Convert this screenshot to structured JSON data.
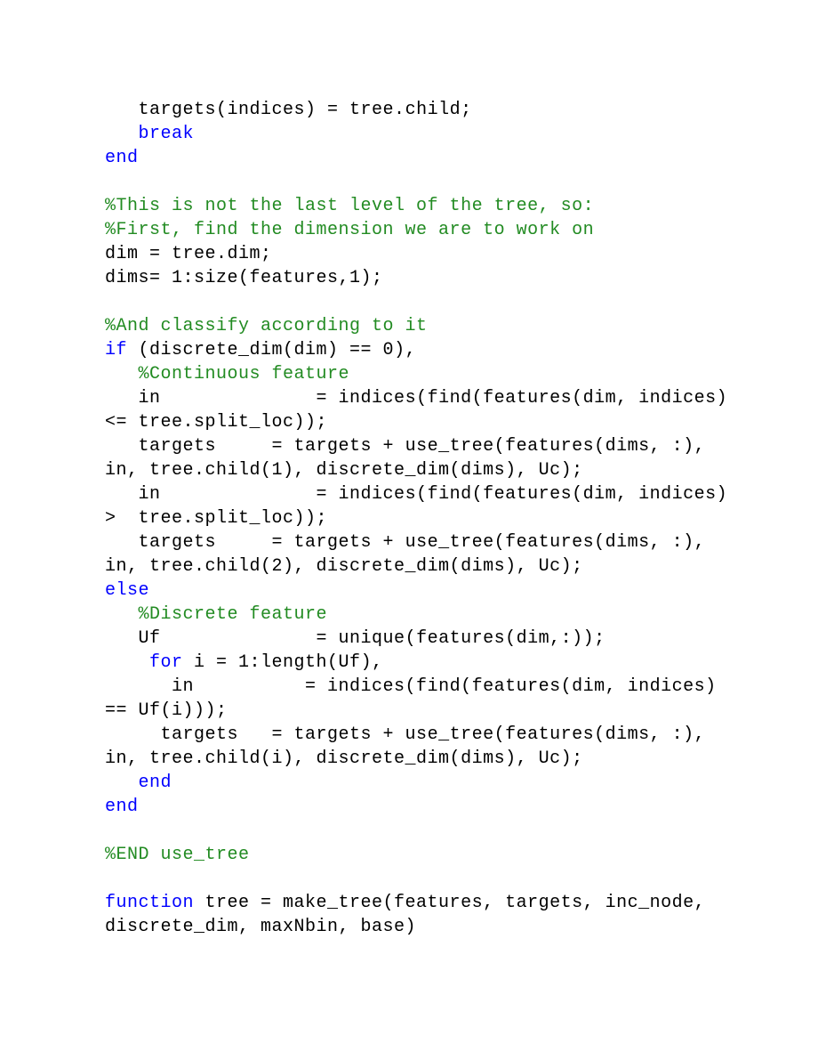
{
  "lines": [
    {
      "segs": [
        {
          "cls": "t",
          "txt": "   targets(indices) = tree.child;"
        }
      ]
    },
    {
      "segs": [
        {
          "cls": "t",
          "txt": "   "
        },
        {
          "cls": "k",
          "txt": "break"
        }
      ]
    },
    {
      "segs": [
        {
          "cls": "k",
          "txt": "end"
        }
      ]
    },
    {
      "segs": [
        {
          "cls": "t",
          "txt": " "
        }
      ]
    },
    {
      "segs": [
        {
          "cls": "c",
          "txt": "%This is not the last level of the tree, so:"
        }
      ]
    },
    {
      "segs": [
        {
          "cls": "c",
          "txt": "%First, find the dimension we are to work on"
        }
      ]
    },
    {
      "segs": [
        {
          "cls": "t",
          "txt": "dim = tree.dim;"
        }
      ]
    },
    {
      "segs": [
        {
          "cls": "t",
          "txt": "dims= 1:size(features,1);"
        }
      ]
    },
    {
      "segs": [
        {
          "cls": "t",
          "txt": " "
        }
      ]
    },
    {
      "segs": [
        {
          "cls": "c",
          "txt": "%And classify according to it"
        }
      ]
    },
    {
      "segs": [
        {
          "cls": "k",
          "txt": "if"
        },
        {
          "cls": "t",
          "txt": " (discrete_dim(dim) == 0),"
        }
      ]
    },
    {
      "segs": [
        {
          "cls": "t",
          "txt": "   "
        },
        {
          "cls": "c",
          "txt": "%Continuous feature"
        }
      ]
    },
    {
      "segs": [
        {
          "cls": "t",
          "txt": "   in              = indices(find(features(dim, indices) <= tree.split_loc));"
        }
      ]
    },
    {
      "segs": [
        {
          "cls": "t",
          "txt": "   targets     = targets + use_tree(features(dims, :), in, tree.child(1), discrete_dim(dims), Uc);"
        }
      ]
    },
    {
      "segs": [
        {
          "cls": "t",
          "txt": "   in              = indices(find(features(dim, indices) >  tree.split_loc));"
        }
      ]
    },
    {
      "segs": [
        {
          "cls": "t",
          "txt": "   targets     = targets + use_tree(features(dims, :), in, tree.child(2), discrete_dim(dims), Uc);"
        }
      ]
    },
    {
      "segs": [
        {
          "cls": "k",
          "txt": "else"
        }
      ]
    },
    {
      "segs": [
        {
          "cls": "t",
          "txt": "   "
        },
        {
          "cls": "c",
          "txt": "%Discrete feature"
        }
      ]
    },
    {
      "segs": [
        {
          "cls": "t",
          "txt": "   Uf              = unique(features(dim,:));"
        }
      ]
    },
    {
      "segs": [
        {
          "cls": "t",
          "txt": "    "
        },
        {
          "cls": "k",
          "txt": "for"
        },
        {
          "cls": "t",
          "txt": " i = 1:length(Uf),"
        }
      ]
    },
    {
      "segs": [
        {
          "cls": "t",
          "txt": "      in          = indices(find(features(dim, indices) == Uf(i)));"
        }
      ]
    },
    {
      "segs": [
        {
          "cls": "t",
          "txt": "     targets   = targets + use_tree(features(dims, :), in, tree.child(i), discrete_dim(dims), Uc);"
        }
      ]
    },
    {
      "segs": [
        {
          "cls": "t",
          "txt": "   "
        },
        {
          "cls": "k",
          "txt": "end"
        }
      ]
    },
    {
      "segs": [
        {
          "cls": "k",
          "txt": "end"
        }
      ]
    },
    {
      "segs": [
        {
          "cls": "t",
          "txt": " "
        }
      ]
    },
    {
      "segs": [
        {
          "cls": "c",
          "txt": "%END use_tree"
        }
      ]
    },
    {
      "segs": [
        {
          "cls": "t",
          "txt": " "
        }
      ]
    },
    {
      "segs": [
        {
          "cls": "k",
          "txt": "function"
        },
        {
          "cls": "t",
          "txt": " tree = make_tree(features, targets, inc_node, discrete_dim, maxNbin, base)"
        }
      ]
    }
  ]
}
